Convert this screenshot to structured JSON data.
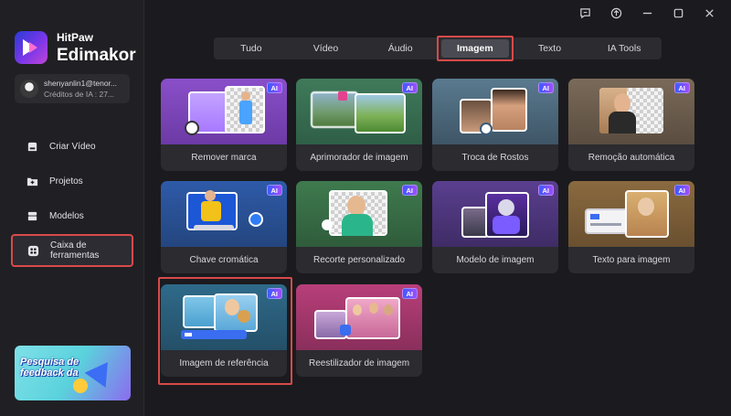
{
  "brand": {
    "line1": "HitPaw",
    "line2": "Edimakor"
  },
  "user": {
    "email": "shenyanlin1@tenor...",
    "credits": "Créditos de IA : 27..."
  },
  "nav": [
    {
      "label": "Criar Vídeo",
      "icon": "create-video-icon"
    },
    {
      "label": "Projetos",
      "icon": "projects-icon"
    },
    {
      "label": "Modelos",
      "icon": "templates-icon"
    },
    {
      "label": "Caixa de ferramentas",
      "icon": "toolbox-icon",
      "active": true
    }
  ],
  "feedback": {
    "text": "Pesquisa de feedback da"
  },
  "window_controls": [
    "feedback-icon",
    "upload-icon",
    "minimize-icon",
    "maximize-icon",
    "close-icon"
  ],
  "tabs": [
    {
      "label": "Tudo"
    },
    {
      "label": "Vídeo"
    },
    {
      "label": "Áudio"
    },
    {
      "label": "Imagem",
      "active": true
    },
    {
      "label": "Texto"
    },
    {
      "label": "IA Tools"
    }
  ],
  "ai_badge": "AI",
  "tools": [
    {
      "label": "Remover marca"
    },
    {
      "label": "Aprimorador de imagem"
    },
    {
      "label": "Troca de Rostos"
    },
    {
      "label": "Remoção automática"
    },
    {
      "label": "Chave cromática"
    },
    {
      "label": "Recorte personalizado"
    },
    {
      "label": "Modelo de imagem"
    },
    {
      "label": "Texto para imagem"
    },
    {
      "label": "Imagem de referência",
      "highlighted": true
    },
    {
      "label": "Reestilizador de imagem"
    }
  ],
  "colors": {
    "background": "#1b1b1f",
    "sidebar": "#202024",
    "card": "#2b2b30",
    "highlight": "#d84a4a",
    "ai_badge_start": "#3b5cff",
    "ai_badge_end": "#a34cff"
  }
}
